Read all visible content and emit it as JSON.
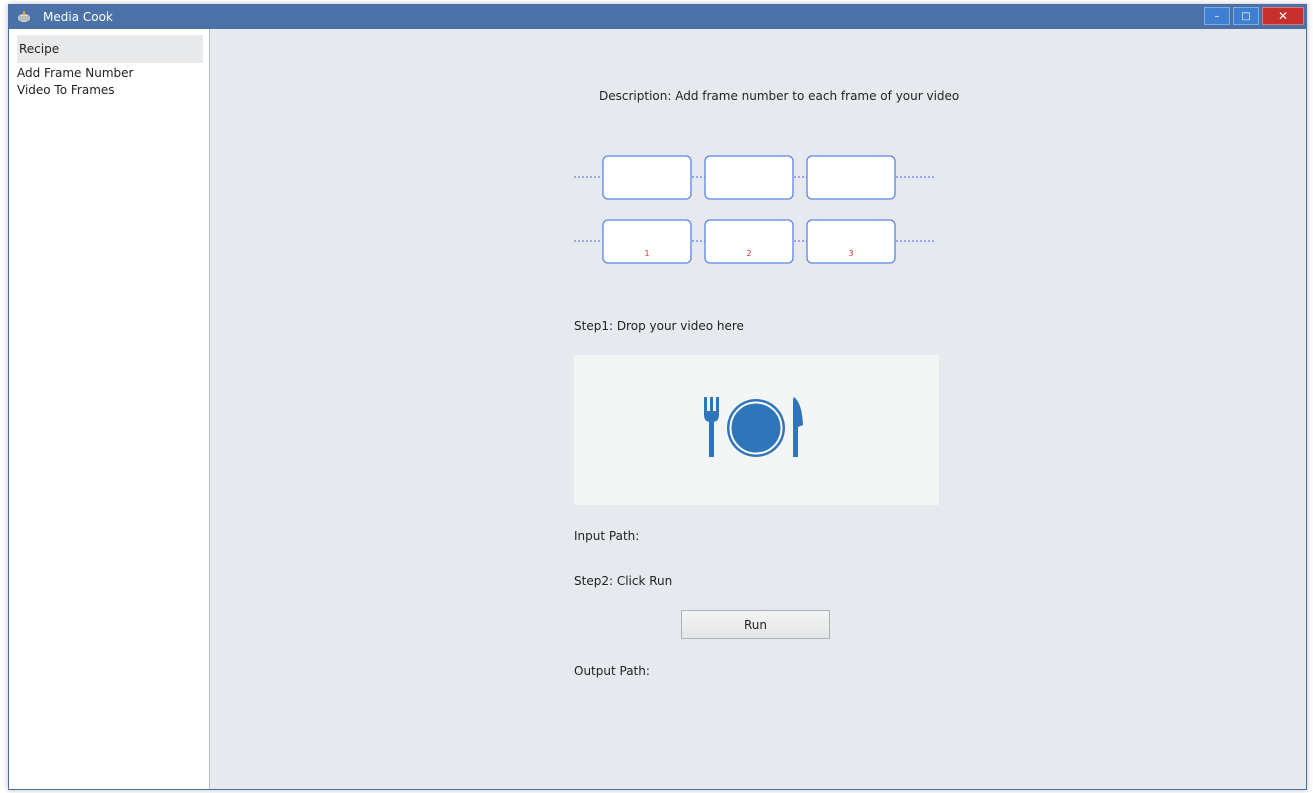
{
  "window": {
    "title": "Media Cook"
  },
  "titlebar": {
    "minimize_glyph": "–",
    "maximize_glyph": "□",
    "close_glyph": "✕"
  },
  "sidebar": {
    "header": "Recipe",
    "items": [
      {
        "label": "Add Frame Number"
      },
      {
        "label": "Video To Frames"
      }
    ]
  },
  "main": {
    "description": "Description: Add frame number to each frame of your video",
    "diagram": {
      "frame_numbers": [
        "1",
        "2",
        "3"
      ],
      "border_color": "#5b86e5",
      "number_color": "#d33"
    },
    "step1_label": "Step1: Drop your video here",
    "drop_zone_icon": "plate-fork-knife-icon",
    "input_path_label": "Input Path:",
    "step2_label": "Step2: Click Run",
    "run_button_label": "Run",
    "output_path_label": "Output Path:"
  },
  "colors": {
    "titlebar": "#4a71a8",
    "accent_icon": "#2f75ba",
    "close_button": "#c9302c"
  }
}
